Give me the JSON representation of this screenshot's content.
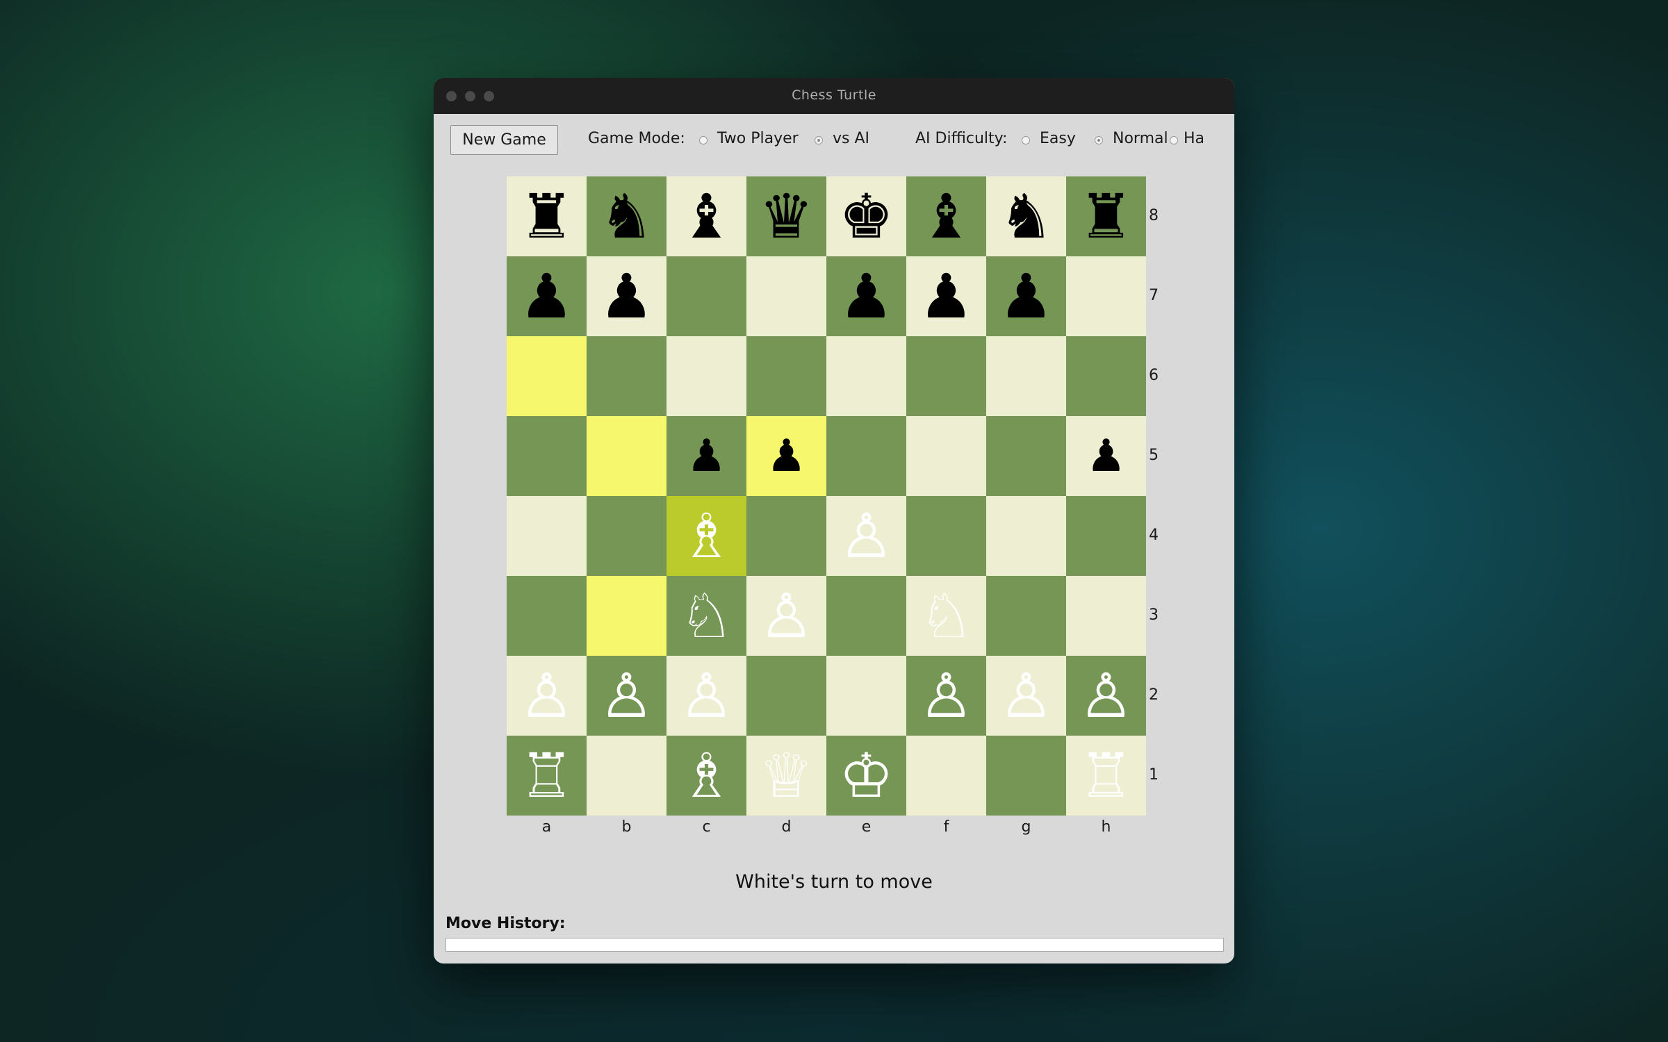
{
  "window": {
    "title": "Chess Turtle"
  },
  "toolbar": {
    "new_game_label": "New Game",
    "game_mode_label": "Game Mode:",
    "game_modes": [
      {
        "label": "Two Player",
        "selected": false
      },
      {
        "label": "vs AI",
        "selected": true
      }
    ],
    "difficulty_label": "AI Difficulty:",
    "difficulties": [
      {
        "label": "Easy",
        "selected": false
      },
      {
        "label": "Normal",
        "selected": true
      },
      {
        "label": "Ha",
        "selected": false
      }
    ]
  },
  "board": {
    "files": [
      "a",
      "b",
      "c",
      "d",
      "e",
      "f",
      "g",
      "h"
    ],
    "ranks": [
      "8",
      "7",
      "6",
      "5",
      "4",
      "3",
      "2",
      "1"
    ],
    "selected_square": "c4",
    "highlighted_squares": [
      "a6",
      "b5",
      "d5",
      "b3"
    ],
    "pieces": [
      {
        "square": "a8",
        "piece": "rook",
        "color": "black",
        "glyph": "♜"
      },
      {
        "square": "b8",
        "piece": "knight",
        "color": "black",
        "glyph": "♞"
      },
      {
        "square": "c8",
        "piece": "bishop",
        "color": "black",
        "glyph": "♝"
      },
      {
        "square": "d8",
        "piece": "queen",
        "color": "black",
        "glyph": "♛"
      },
      {
        "square": "e8",
        "piece": "king",
        "color": "black",
        "glyph": "♚"
      },
      {
        "square": "f8",
        "piece": "bishop",
        "color": "black",
        "glyph": "♝"
      },
      {
        "square": "g8",
        "piece": "knight",
        "color": "black",
        "glyph": "♞"
      },
      {
        "square": "h8",
        "piece": "rook",
        "color": "black",
        "glyph": "♜"
      },
      {
        "square": "a7",
        "piece": "pawn",
        "color": "black",
        "glyph": "♟"
      },
      {
        "square": "b7",
        "piece": "pawn",
        "color": "black",
        "glyph": "♟"
      },
      {
        "square": "e7",
        "piece": "pawn",
        "color": "black",
        "glyph": "♟"
      },
      {
        "square": "f7",
        "piece": "pawn",
        "color": "black",
        "glyph": "♟"
      },
      {
        "square": "g7",
        "piece": "pawn",
        "color": "black",
        "glyph": "♟"
      },
      {
        "square": "c5",
        "piece": "pawn",
        "color": "black",
        "glyph": "♟"
      },
      {
        "square": "d5",
        "piece": "pawn",
        "color": "black",
        "glyph": "♟"
      },
      {
        "square": "h5",
        "piece": "pawn",
        "color": "black",
        "glyph": "♟"
      },
      {
        "square": "c4",
        "piece": "bishop",
        "color": "white",
        "glyph": "♗"
      },
      {
        "square": "e4",
        "piece": "pawn",
        "color": "white",
        "glyph": "♙"
      },
      {
        "square": "c3",
        "piece": "knight",
        "color": "white",
        "glyph": "♘"
      },
      {
        "square": "d3",
        "piece": "pawn",
        "color": "white",
        "glyph": "♙"
      },
      {
        "square": "f3",
        "piece": "knight",
        "color": "white",
        "glyph": "♘"
      },
      {
        "square": "a2",
        "piece": "pawn",
        "color": "white",
        "glyph": "♙"
      },
      {
        "square": "b2",
        "piece": "pawn",
        "color": "white",
        "glyph": "♙"
      },
      {
        "square": "c2",
        "piece": "pawn",
        "color": "white",
        "glyph": "♙"
      },
      {
        "square": "f2",
        "piece": "pawn",
        "color": "white",
        "glyph": "♙"
      },
      {
        "square": "g2",
        "piece": "pawn",
        "color": "white",
        "glyph": "♙"
      },
      {
        "square": "h2",
        "piece": "pawn",
        "color": "white",
        "glyph": "♙"
      },
      {
        "square": "a1",
        "piece": "rook",
        "color": "white",
        "glyph": "♖"
      },
      {
        "square": "c1",
        "piece": "bishop",
        "color": "white",
        "glyph": "♗"
      },
      {
        "square": "d1",
        "piece": "queen",
        "color": "white",
        "glyph": "♕"
      },
      {
        "square": "e1",
        "piece": "king",
        "color": "white",
        "glyph": "♔"
      },
      {
        "square": "h1",
        "piece": "rook",
        "color": "white",
        "glyph": "♖"
      }
    ],
    "colors": {
      "light": "#eeeed2",
      "dark": "#769656",
      "highlight": "#f7f76d",
      "selected": "#bbcb2b"
    }
  },
  "status": {
    "text": "White's turn to move"
  },
  "history": {
    "label": "Move History:"
  }
}
